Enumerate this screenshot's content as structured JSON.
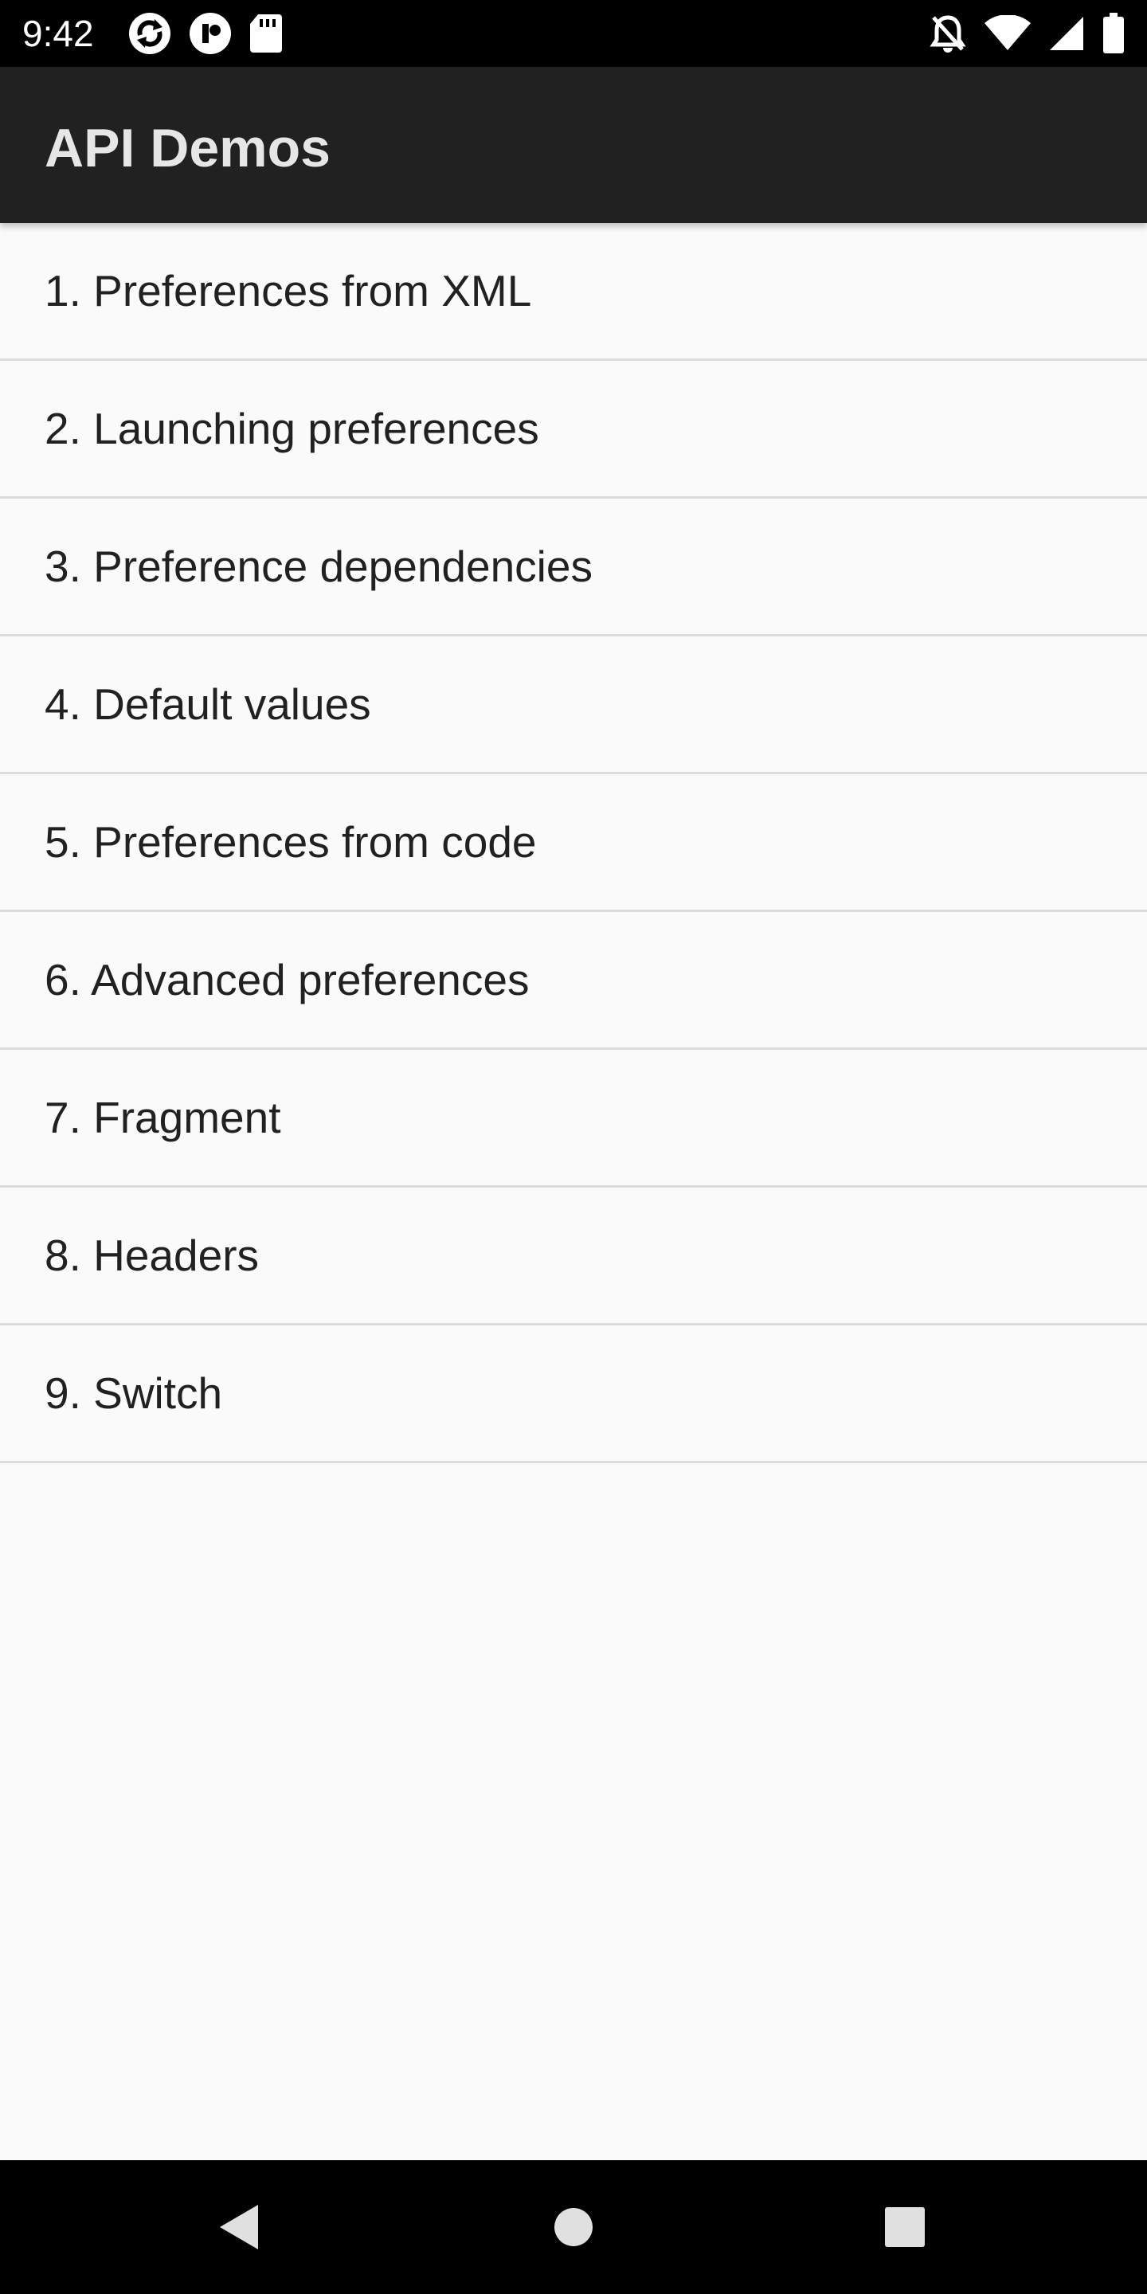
{
  "status_bar": {
    "time": "9:42",
    "left_icons": [
      "sync-icon",
      "notification-app-icon",
      "sd-card-icon"
    ],
    "right_icons": [
      "notifications-off-icon",
      "wifi-icon",
      "cell-signal-icon",
      "battery-icon"
    ]
  },
  "app_bar": {
    "title": "API Demos"
  },
  "list": {
    "items": [
      {
        "label": "1. Preferences from XML"
      },
      {
        "label": "2. Launching preferences"
      },
      {
        "label": "3. Preference dependencies"
      },
      {
        "label": "4. Default values"
      },
      {
        "label": "5. Preferences from code"
      },
      {
        "label": "6. Advanced preferences"
      },
      {
        "label": "7. Fragment"
      },
      {
        "label": "8. Headers"
      },
      {
        "label": "9. Switch"
      }
    ]
  },
  "nav_bar": {
    "buttons": [
      "back-icon",
      "home-icon",
      "recents-icon"
    ]
  },
  "colors": {
    "status_bar": "#000000",
    "app_bar": "#212121",
    "background": "#fafafa",
    "divider": "#dcdcdc",
    "text": "#212121",
    "nav_bar": "#000000"
  }
}
